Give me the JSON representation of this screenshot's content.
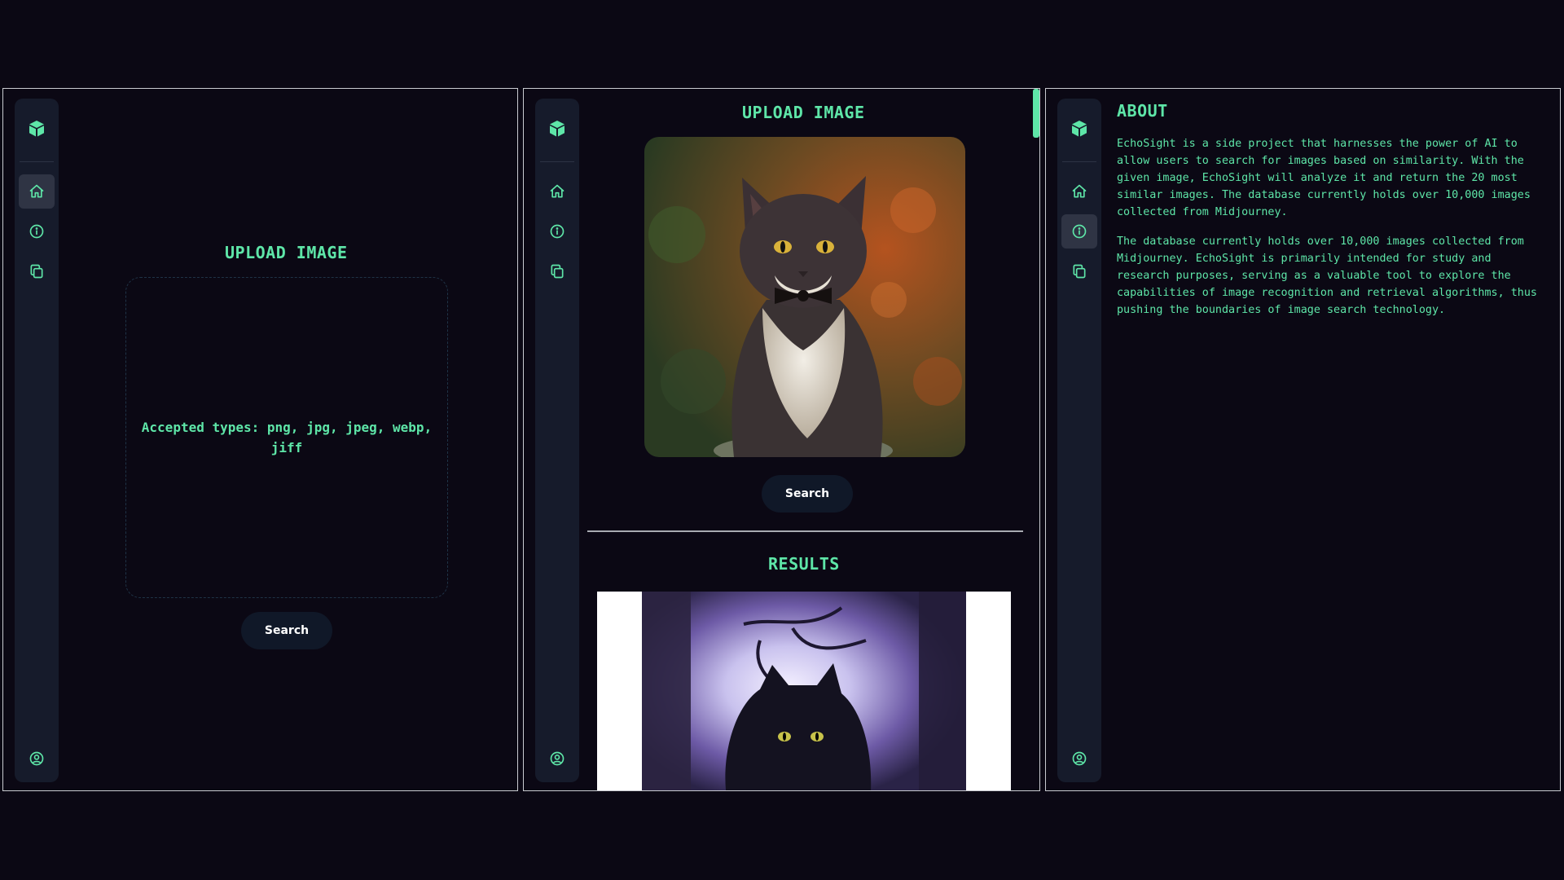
{
  "screens": {
    "upload_empty": {
      "title": "UPLOAD IMAGE",
      "accepted_types": "Accepted types: png, jpg, jpeg, webp, jiff",
      "search_label": "Search"
    },
    "upload_results": {
      "title": "UPLOAD IMAGE",
      "search_label": "Search",
      "results_title": "RESULTS"
    },
    "about": {
      "title": "ABOUT",
      "paragraph_1": "EchoSight is a side project that harnesses the power of AI to allow users to search for images based on similarity. With the given image, EchoSight will analyze it and return the 20 most similar images. The database currently holds over 10,000 images collected from Midjourney.",
      "paragraph_2": "The database currently holds over 10,000 images collected from Midjourney. EchoSight is primarily intended for study and research purposes, serving as a valuable tool to explore the capabilities of image recognition and retrieval algorithms, thus pushing the boundaries of image search technology."
    }
  },
  "sidebar": {
    "icons": [
      "cube-logo-icon",
      "home-icon",
      "info-icon",
      "copy-icon",
      "user-circle-icon"
    ]
  },
  "colors": {
    "background": "#0b0814",
    "accent": "#5ee6a8",
    "sidebar": "#161b2b",
    "button": "#101828"
  }
}
